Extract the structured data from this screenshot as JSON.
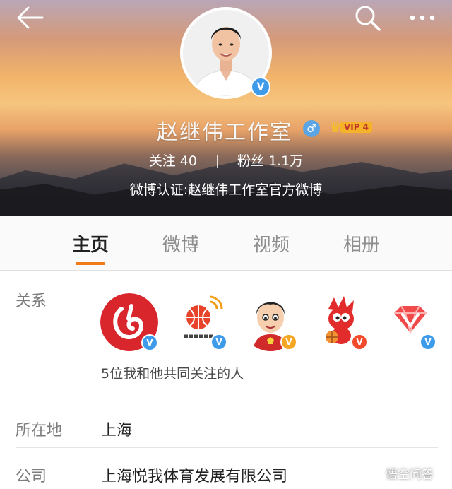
{
  "header": {
    "name": "赵继伟工作室",
    "gender_symbol": "♂",
    "vip_label": "VIP 4",
    "following_label": "关注",
    "following_count": "40",
    "followers_label": "粉丝",
    "followers_count": "1.1万",
    "verification": "微博认证:赵继伟工作室官方微博"
  },
  "tabs": [
    {
      "label": "主页",
      "active": true
    },
    {
      "label": "微博",
      "active": false
    },
    {
      "label": "视频",
      "active": false
    },
    {
      "label": "相册",
      "active": false
    }
  ],
  "relations": {
    "label": "关系",
    "common_text": "5位我和他共同关注的人",
    "avatar_badge": "V",
    "icons": [
      "netease-app-icon",
      "weibo-basketball-icon",
      "cartoon-player-icon",
      "sina-mascot-icon",
      "red-diamond-icon"
    ]
  },
  "location": {
    "label": "所在地",
    "value": "上海"
  },
  "company": {
    "label": "公司",
    "value": "上海悦我体育发展有限公司"
  },
  "watermark": "悟空问答",
  "colors": {
    "accent": "#f07b18",
    "verified_blue": "#3d9be9",
    "verified_gold": "#f5a623"
  }
}
